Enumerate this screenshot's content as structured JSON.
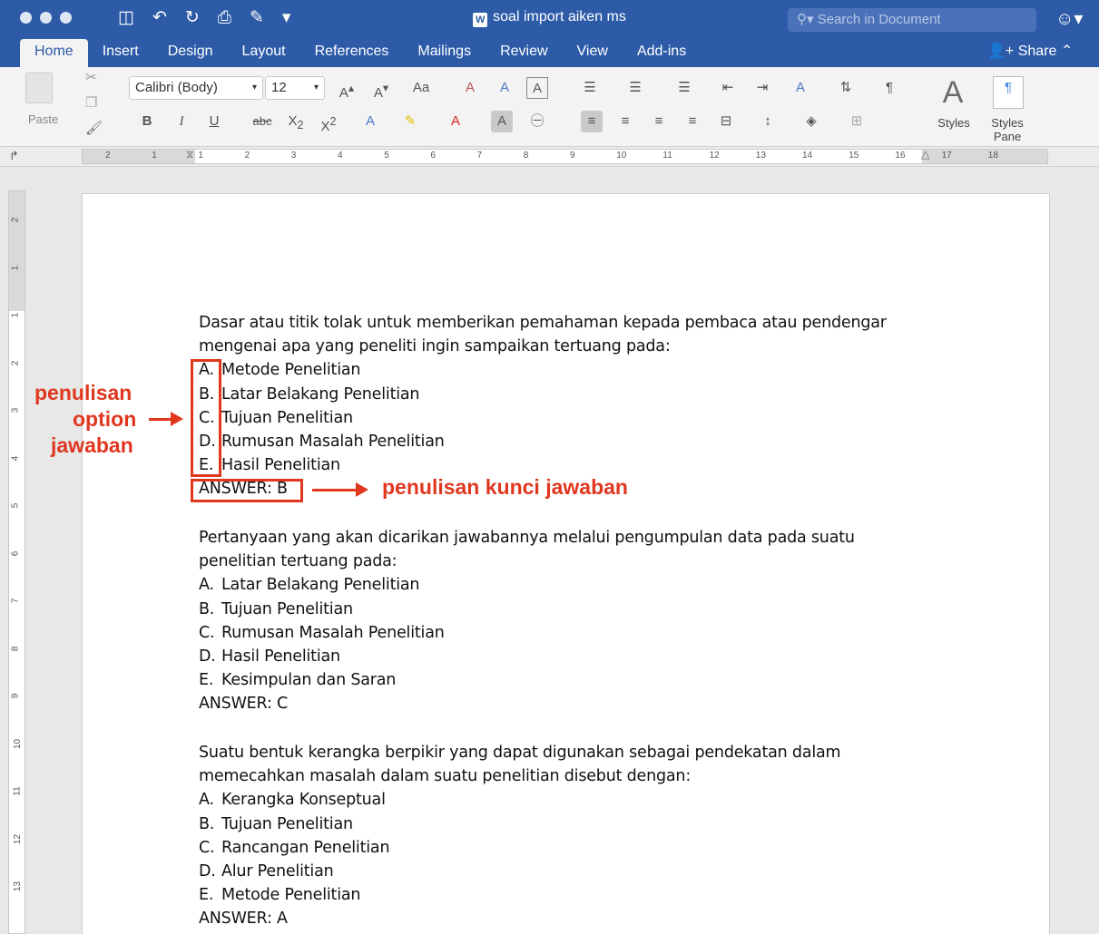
{
  "window": {
    "title": "soal import aiken ms",
    "title_icon": "W",
    "search_placeholder": "Search in Document"
  },
  "tabs": [
    "Home",
    "Insert",
    "Design",
    "Layout",
    "References",
    "Mailings",
    "Review",
    "View",
    "Add-ins"
  ],
  "share_label": "Share",
  "ribbon": {
    "paste_label": "Paste",
    "font_name": "Calibri (Body)",
    "font_size": "12",
    "styles_label": "Styles",
    "styles_pane_label": "Styles Pane"
  },
  "ruler_numbers": [
    "2",
    "1",
    "1",
    "2",
    "3",
    "4",
    "5",
    "6",
    "7",
    "8",
    "9",
    "10",
    "11",
    "12",
    "13",
    "14",
    "15",
    "16",
    "17",
    "18"
  ],
  "vruler_numbers": [
    "2",
    "1",
    "1",
    "2",
    "3",
    "4",
    "5",
    "6",
    "7",
    "8",
    "9",
    "10",
    "11",
    "12",
    "13"
  ],
  "questions": [
    {
      "stem": [
        "Dasar atau titik tolak untuk memberikan pemahaman kepada pembaca atau pendengar",
        "mengenai apa yang peneliti ingin sampaikan tertuang pada:"
      ],
      "options": [
        {
          "letter": "A.",
          "text": "Metode Penelitian"
        },
        {
          "letter": "B.",
          "text": "Latar Belakang Penelitian"
        },
        {
          "letter": "C.",
          "text": "Tujuan Penelitian"
        },
        {
          "letter": "D.",
          "text": "Rumusan Masalah Penelitian"
        },
        {
          "letter": "E.",
          "text": "Hasil Penelitian"
        }
      ],
      "answer": "ANSWER: B"
    },
    {
      "stem": [
        "Pertanyaan yang akan dicarikan jawabannya melalui pengumpulan data pada suatu",
        "penelitian tertuang pada:"
      ],
      "options": [
        {
          "letter": "A.",
          "text": "Latar Belakang Penelitian"
        },
        {
          "letter": "B.",
          "text": "Tujuan Penelitian"
        },
        {
          "letter": "C.",
          "text": "Rumusan Masalah Penelitian"
        },
        {
          "letter": "D.",
          "text": "Hasil Penelitian"
        },
        {
          "letter": "E.",
          "text": "Kesimpulan dan Saran"
        }
      ],
      "answer": "ANSWER: C"
    },
    {
      "stem": [
        "Suatu bentuk kerangka berpikir yang dapat digunakan sebagai pendekatan dalam",
        "memecahkan masalah dalam suatu penelitian disebut dengan:"
      ],
      "options": [
        {
          "letter": "A.",
          "text": "Kerangka Konseptual"
        },
        {
          "letter": "B.",
          "text": "Tujuan Penelitian"
        },
        {
          "letter": "C.",
          "text": "Rancangan Penelitian"
        },
        {
          "letter": "D.",
          "text": "Alur Penelitian"
        },
        {
          "letter": "E.",
          "text": "Metode Penelitian"
        }
      ],
      "answer": "ANSWER: A"
    }
  ],
  "annotations": {
    "option_label": [
      "penulisan",
      "option",
      "jawaban"
    ],
    "answer_label": "penulisan kunci jawaban",
    "color": "#e0371f"
  }
}
